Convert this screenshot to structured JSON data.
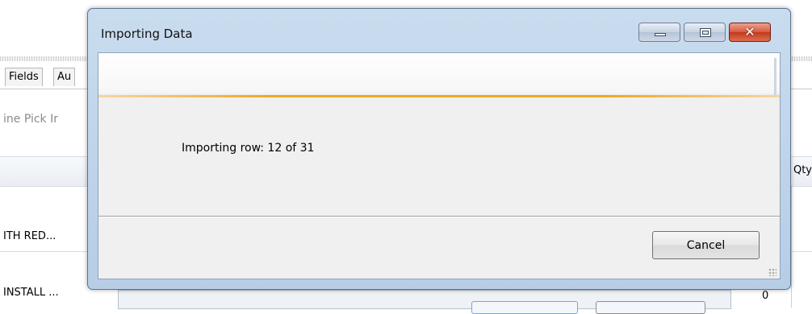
{
  "background_app": {
    "tabs": [
      "Fields",
      "Au"
    ],
    "subtitle": "ine Pick Ir",
    "column_header": "Qty",
    "rows": [
      "ITH RED...",
      "INSTALL ..."
    ],
    "row_value": "0"
  },
  "dialog": {
    "title": "Importing Data",
    "caption_buttons": {
      "minimize_icon": "minimize-icon",
      "maximize_icon": "maximize-icon",
      "close_icon": "close-icon",
      "close_glyph": "✕"
    },
    "status_text": "Importing row: 12 of 31",
    "progress": {
      "current": 12,
      "total": 31
    },
    "cancel_label": "Cancel",
    "accent_color": "#f1a821"
  }
}
